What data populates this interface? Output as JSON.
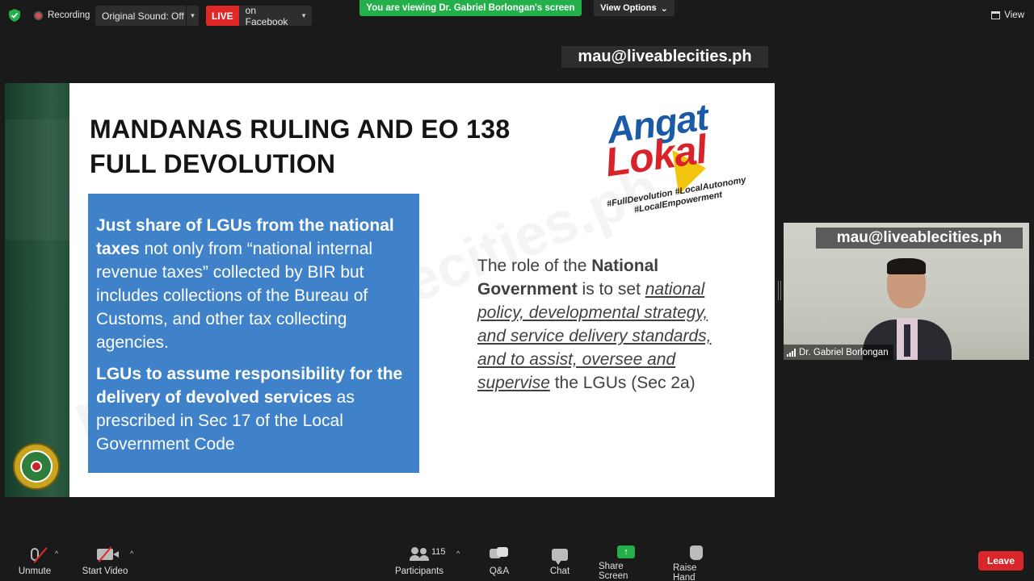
{
  "topbar": {
    "recording_label": "Recording",
    "original_sound": "Original Sound: Off",
    "live_badge": "LIVE",
    "live_target": "on Facebook",
    "viewing_banner": "You are viewing Dr. Gabriel Borlongan's screen",
    "view_options": "View Options",
    "view_label": "View"
  },
  "overlay_email_top": "mau@liveablecities.ph",
  "slide": {
    "title_line1": "MANDANAS RULING AND EO 138",
    "title_line2": "FULL DEVOLUTION",
    "blue_p1_bold": "Just share of LGUs from the national taxes",
    "blue_p1_rest": " not only from “national internal revenue taxes” collected by BIR but includes collections of the Bureau of Customs, and other tax collecting agencies.",
    "blue_p2_bold": "LGUs to assume responsibility for the delivery of devolved services",
    "blue_p2_rest": " as prescribed in Sec 17 of the Local Government Code",
    "right_pre": "The role of the ",
    "right_bold": "National Government",
    "right_mid": " is to set ",
    "right_italic": "national policy, developmental strategy, and service delivery standards, and to assist, oversee and supervise",
    "right_post": " the LGUs (Sec 2a)",
    "logo_word1": "Angat",
    "logo_word2": "Lokal",
    "logo_hashtags": "#FullDevolution #LocalAutonomy #LocalEmpowerment",
    "watermark": "mau@liveablecities.ph"
  },
  "video": {
    "email": "mau@liveablecities.ph",
    "name": "Dr. Gabriel Borlongan"
  },
  "toolbar": {
    "unmute": "Unmute",
    "start_video": "Start Video",
    "participants": "Participants",
    "participants_count": "115",
    "qa": "Q&A",
    "chat": "Chat",
    "share_screen": "Share Screen",
    "raise_hand": "Raise Hand",
    "leave": "Leave"
  },
  "colors": {
    "accent_green": "#23b04a",
    "live_red": "#e02828",
    "slide_blue": "#3f82c9",
    "leave_red": "#d9262b"
  }
}
